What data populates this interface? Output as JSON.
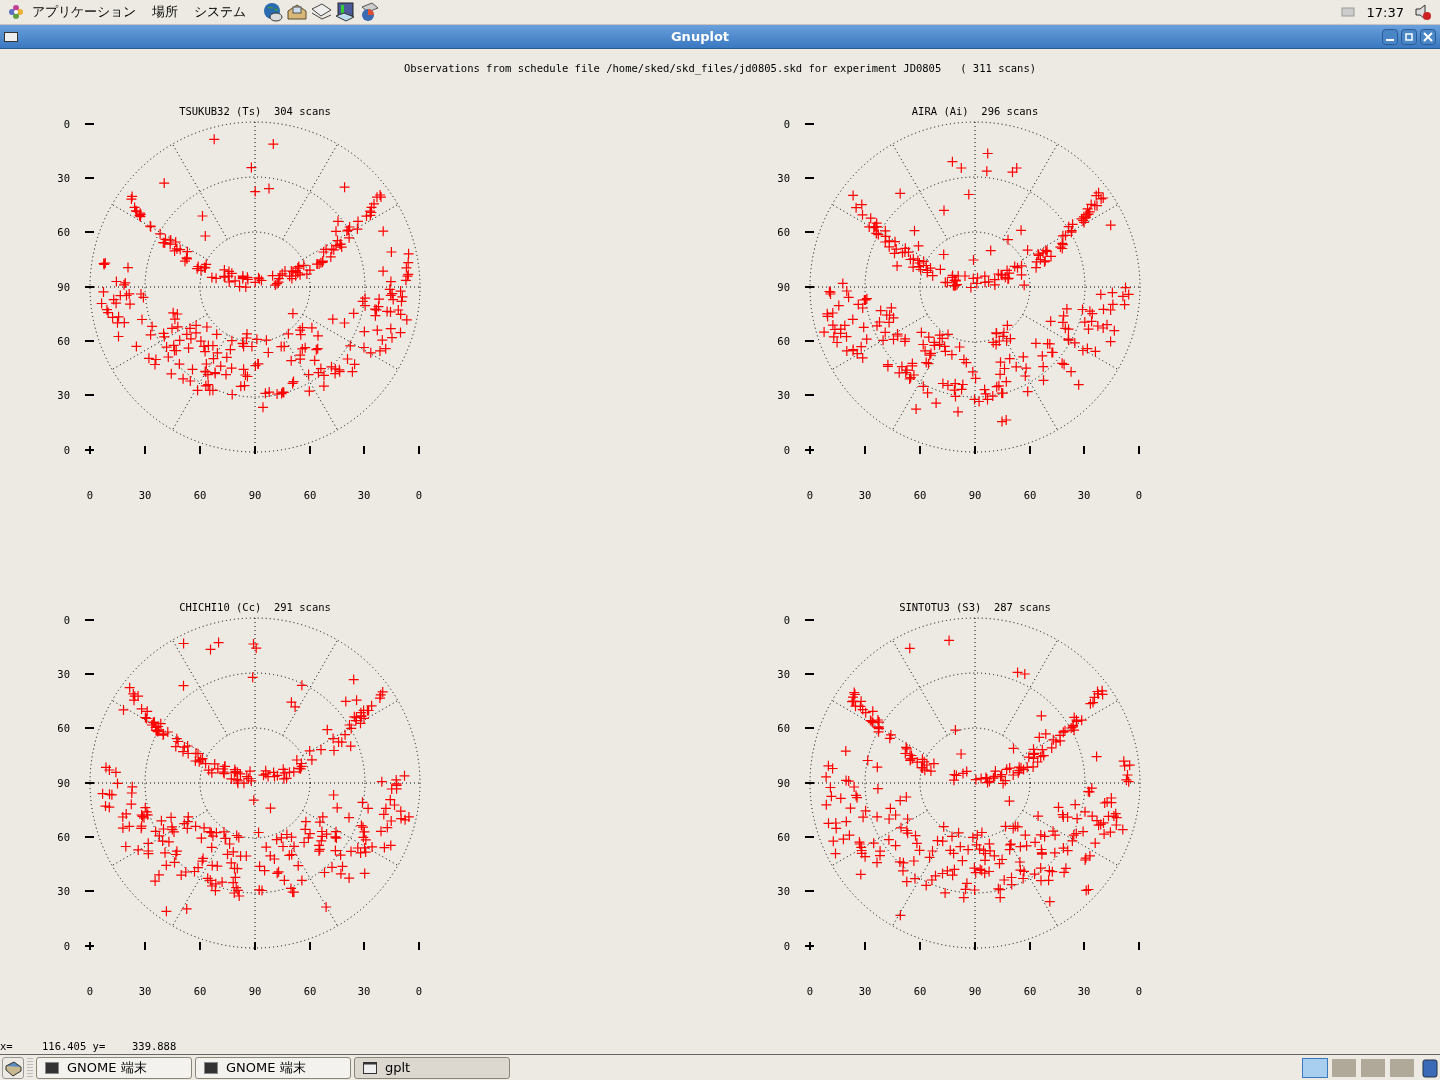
{
  "top_panel": {
    "menus": [
      "アプリケーション",
      "場所",
      "システム"
    ],
    "clock": "17:37"
  },
  "window": {
    "title": "Gnuplot"
  },
  "plot_heading": "Observations from schedule file /home/sked/skd_files/jd0805.skd for experiment JD0805   ( 311 scans)",
  "plots": [
    {
      "title": "TSUKUB32 (Ts)  304 scans",
      "y_ticks": [
        "0",
        "30",
        "60",
        "90",
        "60",
        "30",
        "0"
      ],
      "x_ticks": [
        "0",
        "30",
        "60",
        "90",
        "60",
        "30",
        "0"
      ]
    },
    {
      "title": "AIRA (Ai)  296 scans",
      "y_ticks": [
        "0",
        "30",
        "60",
        "90",
        "60",
        "30",
        "0"
      ],
      "x_ticks": [
        "0",
        "30",
        "60",
        "90",
        "60",
        "30",
        "0"
      ]
    },
    {
      "title": "CHICHI10 (Cc)  291 scans",
      "y_ticks": [
        "0",
        "30",
        "60",
        "90",
        "60",
        "30",
        "0"
      ],
      "x_ticks": [
        "0",
        "30",
        "60",
        "90",
        "60",
        "30",
        "0"
      ]
    },
    {
      "title": "SINTOTU3 (S3)  287 scans",
      "y_ticks": [
        "0",
        "30",
        "60",
        "90",
        "60",
        "30",
        "0"
      ],
      "x_ticks": [
        "0",
        "30",
        "60",
        "90",
        "60",
        "30",
        "0"
      ]
    }
  ],
  "status": {
    "x_label": "x=",
    "x_value": "116.405 y=",
    "y_value": "339.888"
  },
  "taskbar": {
    "items": [
      {
        "label": "GNOME 端末",
        "kind": "terminal",
        "selected": false
      },
      {
        "label": "GNOME 端末",
        "kind": "terminal",
        "selected": false
      },
      {
        "label": "gplt",
        "kind": "window",
        "selected": true
      }
    ],
    "workspaces": [
      {
        "selected": true
      },
      {
        "selected": false
      },
      {
        "selected": false
      },
      {
        "selected": false
      }
    ]
  }
}
